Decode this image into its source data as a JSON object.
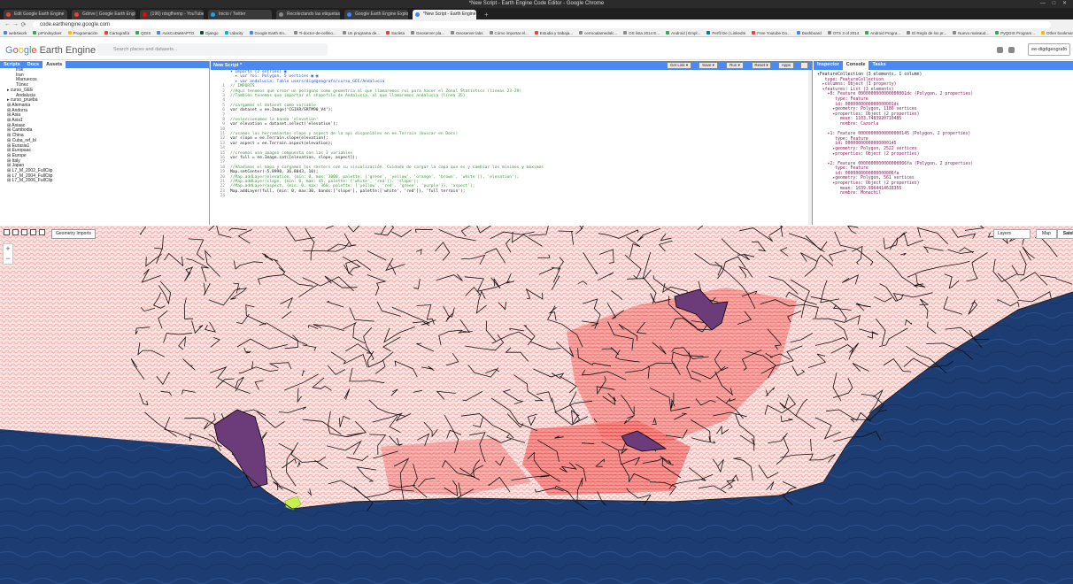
{
  "window": {
    "title": "*New Script - Earth Engine Code Editor - Google Chrome",
    "controls": "— □ ✕"
  },
  "tabs": [
    {
      "label": "Edit Google Earth Engine",
      "color": "#ea4335"
    },
    {
      "label": "Gdrive | Google Earth Engine",
      "color": "#ea4335"
    },
    {
      "label": "(196) rdsgfhemp - YouTube",
      "color": "#ff0000"
    },
    {
      "label": "Inicio / Twitter",
      "color": "#1da1f2"
    },
    {
      "label": "Recolectando las etiquetas del mar (c)",
      "color": "#888888"
    },
    {
      "label": "Google Earth Engine Explorer",
      "color": "#4285f4"
    },
    {
      "label": "*New Script - Earth Engine Co",
      "color": "#4285f4",
      "active": true
    }
  ],
  "address": {
    "url": "code.earthengine.google.com",
    "nav": [
      "←",
      "→",
      "⟳"
    ]
  },
  "bookmarks": [
    {
      "label": "web4work",
      "color": "#4285f4"
    },
    {
      "label": "prFindsydoer",
      "color": "#34a853"
    },
    {
      "label": "Programación",
      "color": "#fbbc05"
    },
    {
      "label": "Cartografía",
      "color": "#ea4335"
    },
    {
      "label": "QGIS",
      "color": "#34a853"
    },
    {
      "label": "AxisCoDaMAPTO",
      "color": "#4285f4"
    },
    {
      "label": "Django",
      "color": "#0c4b33"
    },
    {
      "label": "Udacity",
      "color": "#02b3e4"
    },
    {
      "label": "Google Earth En...",
      "color": "#4285f4"
    },
    {
      "label": "Ti-doctor-de-cellino...",
      "color": "#888888"
    },
    {
      "label": "Un programa de...",
      "color": "#888888"
    },
    {
      "label": "Sacleta",
      "color": "#ea4335"
    },
    {
      "label": "Geoserver pla...",
      "color": "#888888"
    },
    {
      "label": "Geoserver labs",
      "color": "#888888"
    },
    {
      "label": "Cómo importar el...",
      "color": "#888888"
    },
    {
      "label": "Estudia y trabaja...",
      "color": "#ea4335"
    },
    {
      "label": "cerrooalamedalc...",
      "color": "#888888"
    },
    {
      "label": "OS lista 2014 E...",
      "color": "#888888"
    },
    {
      "label": "Android | Empl...",
      "color": "#34a853"
    },
    {
      "label": "Perfil De | LinkedIn",
      "color": "#0077b5"
    },
    {
      "label": "Free Youtube Do...",
      "color": "#ea4335"
    },
    {
      "label": "Dashboard",
      "color": "#4285f4"
    },
    {
      "label": "OTS 3 of 2014",
      "color": "#888888"
    },
    {
      "label": "Android Progra...",
      "color": "#34a853"
    },
    {
      "label": "El Reglo de los pr...",
      "color": "#888888"
    },
    {
      "label": "Nuevo malvaud...",
      "color": "#888888"
    },
    {
      "label": "PyQGIS Program...",
      "color": "#34a853"
    },
    {
      "label": "Other bookmarks",
      "color": "#fbbc05"
    }
  ],
  "header": {
    "logo": [
      "G",
      "o",
      "o",
      "g",
      "l",
      "e",
      " Earth Engine"
    ],
    "search_placeholder": "Search places and datasets...",
    "user": "ee-digdgeografo"
  },
  "left_panel": {
    "tabs": [
      "Scripts",
      "Docs",
      "Assets"
    ],
    "tree": [
      {
        "label": "Irak",
        "indent": 2
      },
      {
        "label": "Iran",
        "indent": 2
      },
      {
        "label": "Marruecos",
        "indent": 2
      },
      {
        "label": "Túnez",
        "indent": 2
      },
      {
        "label": "▸ curso_GEE",
        "indent": 0
      },
      {
        "label": "Andalucia",
        "indent": 2
      },
      {
        "label": "▸ curso_prueba",
        "indent": 0
      },
      {
        "label": "⊞ Alemania",
        "indent": 0
      },
      {
        "label": "⊞ Andorra",
        "indent": 0
      },
      {
        "label": "⊞ Asia",
        "indent": 0
      },
      {
        "label": "⊞ Asia1",
        "indent": 0
      },
      {
        "label": "⊞ Asiaac",
        "indent": 0
      },
      {
        "label": "⊞ Cambodia",
        "indent": 0
      },
      {
        "label": "⊞ China",
        "indent": 0
      },
      {
        "label": "⊞ Cuba_ref_bl",
        "indent": 0
      },
      {
        "label": "⊞ Eurasia1",
        "indent": 0
      },
      {
        "label": "⊞ Europaac",
        "indent": 0
      },
      {
        "label": "⊞ Europe",
        "indent": 0
      },
      {
        "label": "⊞ Italy",
        "indent": 0
      },
      {
        "label": "⊞ Japan",
        "indent": 0
      },
      {
        "label": "⊞ L7_M_2002_FullClip",
        "indent": 0
      },
      {
        "label": "⊞ L7_M_2004_FullClip",
        "indent": 0
      },
      {
        "label": "⊞ L7_M_2006_FullClip",
        "indent": 0
      }
    ]
  },
  "editor": {
    "title": "New Script *",
    "buttons": [
      "Get Link ▾",
      "Save ▾",
      "Run ▾",
      "Reset ▾",
      "Apps"
    ],
    "lines": [
      {
        "n": "",
        "t": "▾ Imports (2 entries) ▣",
        "c": "kw"
      },
      {
        "n": "",
        "t": "  ▸ var roi: Polygon, 5 vertices ▣ ▣",
        "c": "kw"
      },
      {
        "n": "",
        "t": "  ▸ var andalucia: Table users/digdgeografo/curso_GEE/Andalucia",
        "c": "kw"
      },
      {
        "n": "1",
        "t": "// IMPORTS",
        "c": "cm"
      },
      {
        "n": "2",
        "t": "//Aquí tenemos que crear un polígono como geometría al que llamaremos roi para hacer el Zonal Statistics (líneas 23-29)",
        "c": "cm"
      },
      {
        "n": "3",
        "t": "//También tenemos que importar el shapefile de Andalucía, al que llamaremos andalucia (línea 35)",
        "c": "cm"
      },
      {
        "n": "4",
        "t": "",
        "c": "vr"
      },
      {
        "n": "5",
        "t": "//cargamos el dataset como variable",
        "c": "cm"
      },
      {
        "n": "6",
        "t": "var dataset = ee.Image('CGIAR/SRTM90_V4');",
        "c": "vr"
      },
      {
        "n": "7",
        "t": "",
        "c": "vr"
      },
      {
        "n": "8",
        "t": "//seleccionamos la banda 'elevation'",
        "c": "cm"
      },
      {
        "n": "9",
        "t": "var elevation = dataset.select('elevation');",
        "c": "vr"
      },
      {
        "n": "10",
        "t": "",
        "c": "vr"
      },
      {
        "n": "11",
        "t": "//usamos las herramientas slope y aspect de la api disponibles en ee.Terrain (buscar en Docs)",
        "c": "cm"
      },
      {
        "n": "12",
        "t": "var slope = ee.Terrain.slope(elevation);",
        "c": "vr"
      },
      {
        "n": "13",
        "t": "var aspect = ee.Terrain.aspect(elevation);",
        "c": "vr"
      },
      {
        "n": "14",
        "t": "",
        "c": "vr"
      },
      {
        "n": "15",
        "t": "//creamos una imagen compuesta con las 3 variables",
        "c": "cm"
      },
      {
        "n": "16",
        "t": "var full = ee.Image.cat([elevation, slope, aspect]);",
        "c": "vr"
      },
      {
        "n": "17",
        "t": "",
        "c": "vr"
      },
      {
        "n": "18",
        "t": "//Añadimos el mapa y cargamos los rasters con su visualización. Cuidado de cargar la capa que es y cambiar los mínimos y máximos",
        "c": "cm"
      },
      {
        "n": "19",
        "t": "Map.setCenter(-5.8990, 36.8043, 10);",
        "c": "vr"
      },
      {
        "n": "20",
        "t": "//Map.addLayer(elevation, {min: 0, max: 3000, palette: ['green', 'yellow', 'orange', 'brown', 'white']}, 'elevation');",
        "c": "cm"
      },
      {
        "n": "21",
        "t": "//Map.addLayer(slope, {min: 0, max: 45, palette: ['white', 'red']}, 'slope');",
        "c": "cm"
      },
      {
        "n": "22",
        "t": "//Map.addLayer(aspect, {min: 0, max: 360, palette: ['yellow', 'red', 'green', 'purple']}, 'aspect');",
        "c": "cm"
      },
      {
        "n": "23",
        "t": "Map.addLayer(full, {min: 0, max:30, bands:['slope'], palette:['white', 'red']}, 'full terrain');",
        "c": "vr"
      },
      {
        "n": "24",
        "t": "",
        "c": "vr"
      }
    ]
  },
  "right_panel": {
    "tabs": [
      "Inspector",
      "Console",
      "Tasks"
    ],
    "console": [
      {
        "t": "▾FeatureCollection (3 elements, 1 column)",
        "k": false
      },
      {
        "t": "   type: FeatureCollection",
        "k": true
      },
      {
        "t": "  ▸columns: Object (1 property)",
        "k": true
      },
      {
        "t": "  ▾features: List (3 elements)",
        "k": true
      },
      {
        "t": "    ▾0: Feature 0000000000000000001dc (Polygon, 2 properties)",
        "k": true
      },
      {
        "t": "       type: Feature",
        "k": true
      },
      {
        "t": "       id: 0000000000000000001dc",
        "k": true
      },
      {
        "t": "      ▸geometry: Polygon, 1186 vertices",
        "k": true
      },
      {
        "t": "      ▾properties: Object (2 properties)",
        "k": true
      },
      {
        "t": "         mean: 1103.7483920710485",
        "k": true
      },
      {
        "t": "         nombre: Cazorla",
        "k": true
      },
      {
        "t": "",
        "k": false
      },
      {
        "t": "    ▾1: Feature 00000000000000000145 (Polygon, 2 properties)",
        "k": true
      },
      {
        "t": "       type: Feature",
        "k": true
      },
      {
        "t": "       id: 00000000000000000145",
        "k": true
      },
      {
        "t": "      ▸geometry: Polygon, 2522 vertices",
        "k": true
      },
      {
        "t": "      ▸properties: Object (2 properties)",
        "k": true
      },
      {
        "t": "",
        "k": false
      },
      {
        "t": "    ▾2: Feature 0000000000000000006fa (Polygon, 2 properties)",
        "k": true
      },
      {
        "t": "       type: Feature",
        "k": true
      },
      {
        "t": "       id: 0000000000000000006fa",
        "k": true
      },
      {
        "t": "      ▸geometry: Polygon, 561 vertices",
        "k": true
      },
      {
        "t": "      ▾properties: Object (2 properties)",
        "k": true
      },
      {
        "t": "         mean: 1639.9964414618355",
        "k": true
      },
      {
        "t": "         nombre: Monachil",
        "k": true
      }
    ]
  },
  "map": {
    "geometry_imports": "Geometry Imports",
    "layers": "Layers",
    "map_types": [
      "Map",
      "Satellite"
    ],
    "zoom": [
      "+",
      "−"
    ],
    "colors": {
      "sea": "#1b3a6b",
      "land": "#fbe4e2",
      "slope": "#e33a3a",
      "highlight": "#6b3b7a",
      "roi": "#c8f04a"
    }
  }
}
